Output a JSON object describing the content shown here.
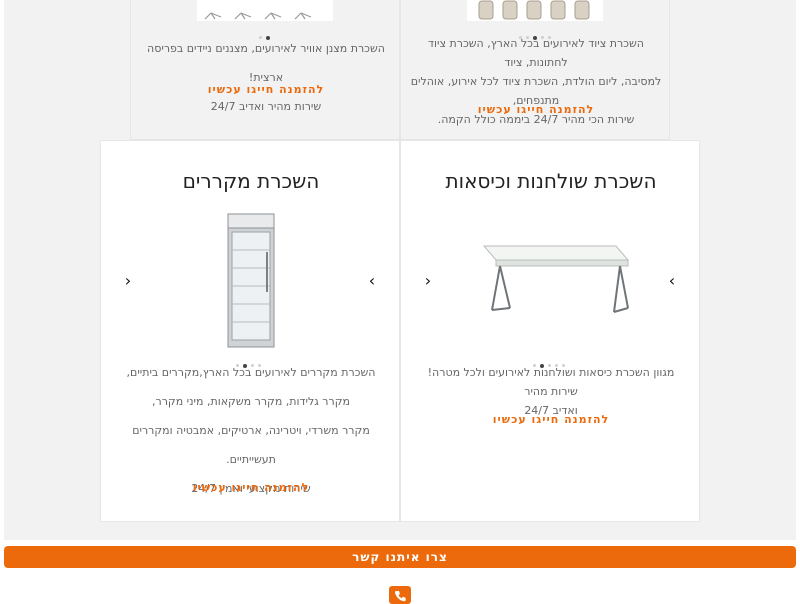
{
  "top_left_card": {
    "lines": [
      "השכרת מצנן אוויר לאירועים, מצננים ניידים בפריסה ארצית!",
      "שירות מהיר ואדיב 24/7"
    ],
    "cta": "להזמנה חייגו עכשיו"
  },
  "top_right_card": {
    "lines": [
      "השכרת ציוד לאירועים בכל הארץ, השכרת ציוד לחתונות, ציוד",
      "למסיבה, ליום הולדת, השכרת ציוד לכל אירוע, אוהלים מתנפחים,",
      "שירות הכי מהיר 24/7 ביממה כולל הקמה."
    ],
    "cta": "להזמנה חייגו עכשיו"
  },
  "fridge_card": {
    "title": "השכרת מקררים",
    "lines": [
      "השכרת מקררים לאירועים בכל הארץ,מקררים ביתיים,",
      "מקרר גלידות, מקרר משקאות, מיני מקרר,",
      "מקרר משרדי, ויטרינה, ארטיקים, אמבטיה ומקררים תעשייתיים.",
      "שירות מקצועי ואמין 24/7"
    ],
    "cta": "להזמנה חייגו עכשיו"
  },
  "tables_card": {
    "title": "השכרת שולחנות וכיסאות",
    "lines": [
      "מגוון השכרת כיסאות ושולחנות לאירועים ולכל מטרה! שירות מהיר",
      "ואדיב 24/7"
    ],
    "cta": "להזמנה חייגו עכשיו"
  },
  "carousel": {
    "prev_icon": "‹",
    "next_icon": "›"
  },
  "contact": {
    "label": "צרו איתנו קשר",
    "phone_icon": "phone-icon"
  },
  "colors": {
    "accent": "#ec6a0c",
    "section_bg": "#f2f2f2",
    "card_border": "#e6e6e6",
    "body_text": "#666666"
  }
}
